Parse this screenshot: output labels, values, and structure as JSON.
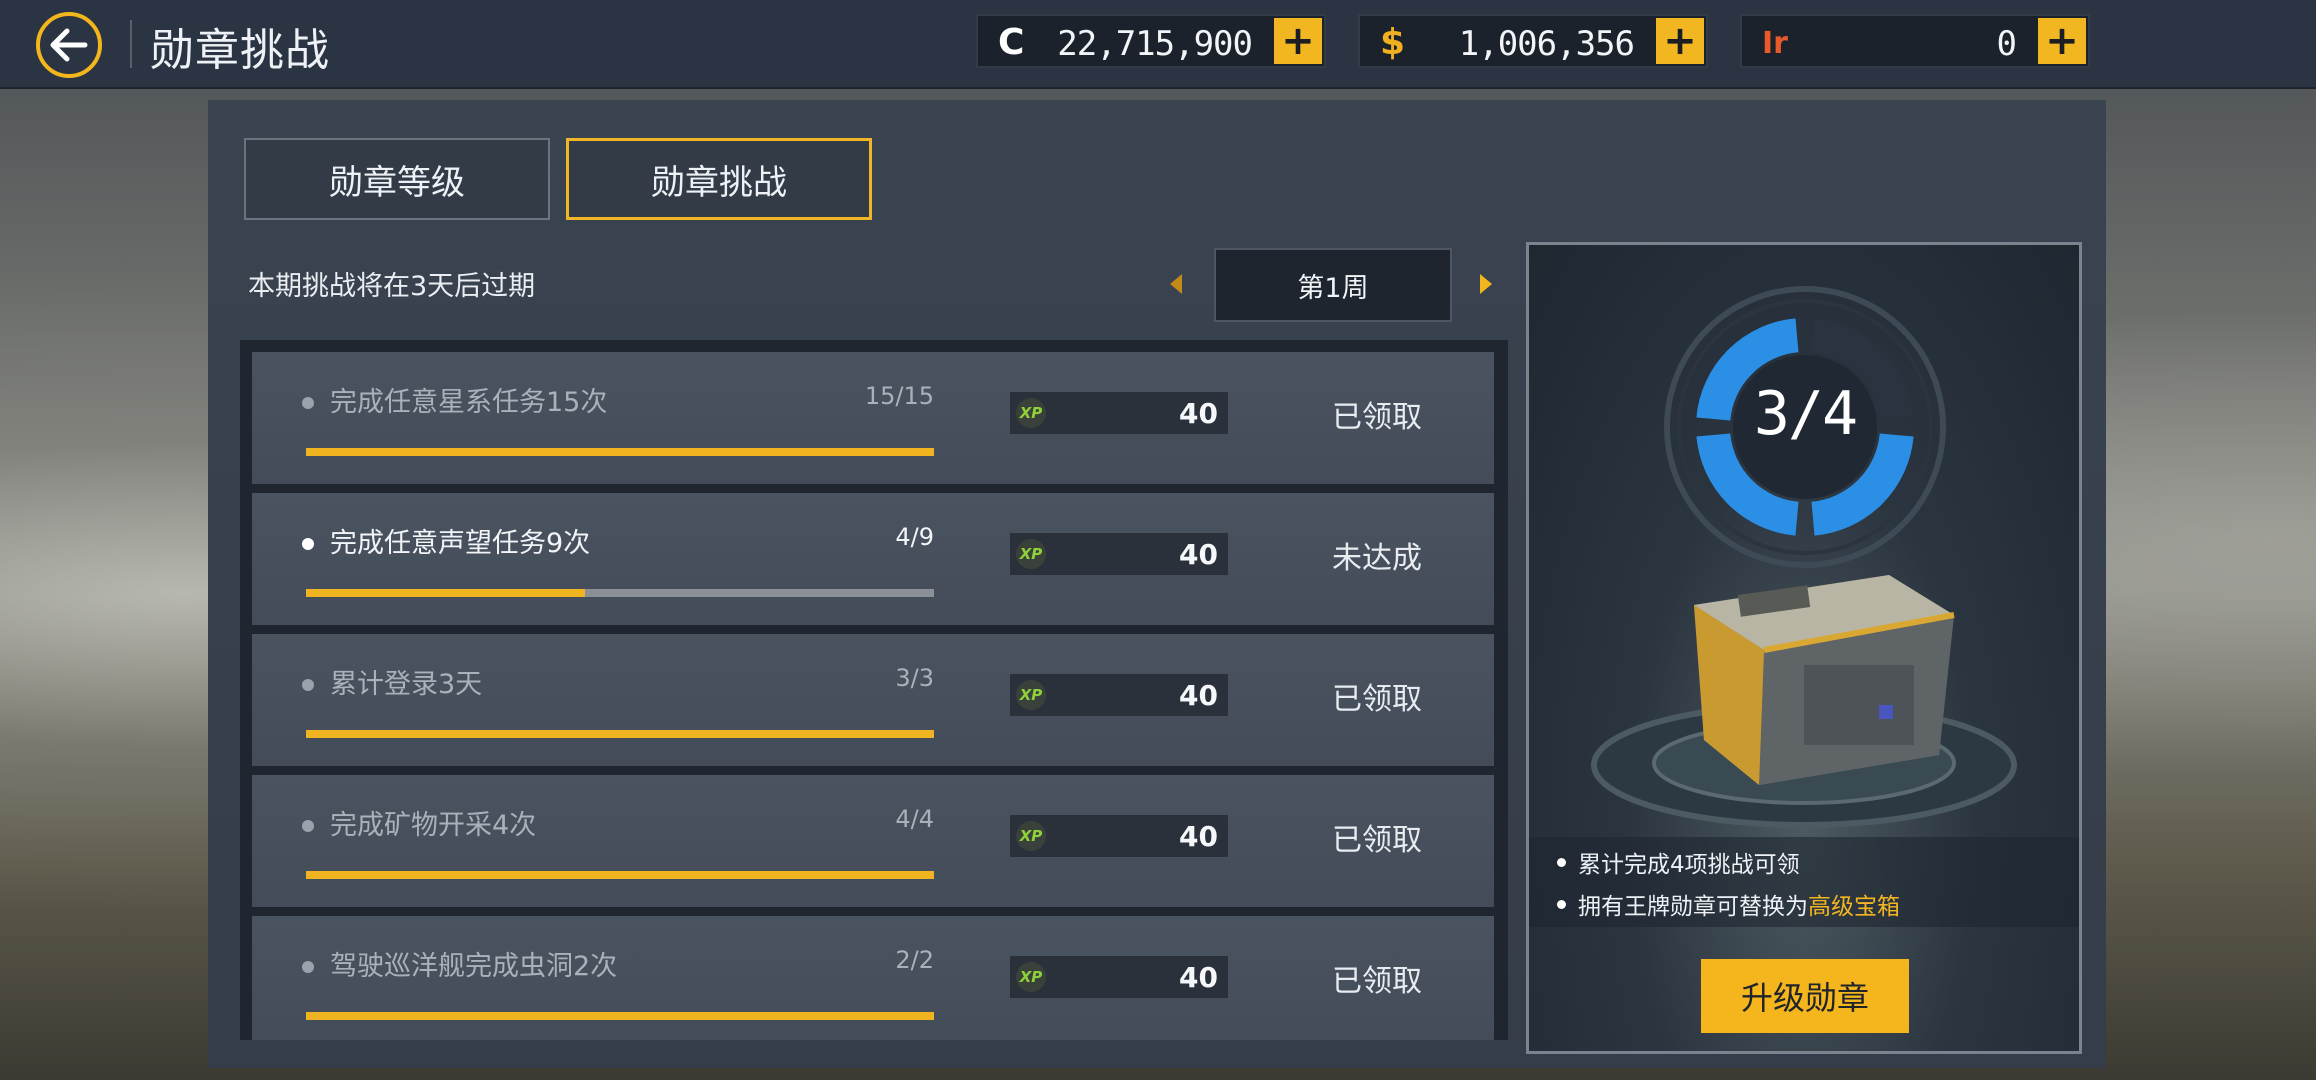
{
  "header": {
    "title": "勋章挑战",
    "currencies": [
      {
        "icon": "C",
        "value": "22,715,900",
        "plus": "+"
      },
      {
        "icon": "$",
        "value": "1,006,356",
        "plus": "+"
      },
      {
        "icon": "Ir",
        "value": "0",
        "plus": "+"
      }
    ]
  },
  "tabs": [
    {
      "label": "勋章等级",
      "active": false
    },
    {
      "label": "勋章挑战",
      "active": true
    }
  ],
  "expire_text": "本期挑战将在3天后过期",
  "week": {
    "label": "第1周"
  },
  "challenges": [
    {
      "name": "完成任意星系任务15次",
      "progress": "15/15",
      "fraction": 1.0,
      "xp_label": "XP",
      "xp": "40",
      "status": "已领取"
    },
    {
      "name": "完成任意声望任务9次",
      "progress": "4/9",
      "fraction": 0.444,
      "xp_label": "XP",
      "xp": "40",
      "status": "未达成"
    },
    {
      "name": "累计登录3天",
      "progress": "3/3",
      "fraction": 1.0,
      "xp_label": "XP",
      "xp": "40",
      "status": "已领取"
    },
    {
      "name": "完成矿物开采4次",
      "progress": "4/4",
      "fraction": 1.0,
      "xp_label": "XP",
      "xp": "40",
      "status": "已领取"
    },
    {
      "name": "驾驶巡洋舰完成虫洞2次",
      "progress": "2/2",
      "fraction": 1.0,
      "xp_label": "XP",
      "xp": "40",
      "status": "已领取"
    }
  ],
  "reward": {
    "ring_label": "3/4",
    "completed": 3,
    "total": 4,
    "note1": "累计完成4项挑战可领",
    "note2_prefix": "拥有王牌勋章可替换为",
    "note2_highlight": "高级宝箱",
    "button": "升级勋章"
  },
  "colors": {
    "accent": "#f2b620",
    "ring": "#2b8fe6",
    "xp": "#8fd13a"
  }
}
